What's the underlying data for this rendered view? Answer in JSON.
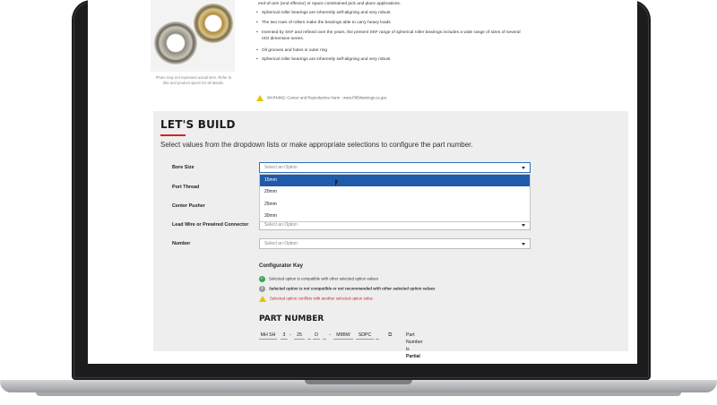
{
  "product": {
    "image_note": "Photo may not represent actual item. Refer to title and product specs for all details.",
    "lead_text": "end-of-arm (end effector) or space constrained pick and place applications.",
    "bullets": [
      "Spherical roller bearings are inherently self-aligning and very robust",
      "The two rows of rollers make the bearings able to carry heavy loads",
      "Invented by SKF and refined over the years, the present SKF range of spherical roller bearings includes a wide range of sizes of several ISO dimension series.",
      "Oil grooves and holes in outer ring",
      "Spherical roller bearings are inherently self-aligning and very robust"
    ],
    "warning": "WARNING: Cancer and Reproductive Harm - www.P65Warnings.ca.gov"
  },
  "build": {
    "title": "LET'S BUILD",
    "subtitle": "Select values from the dropdown lists or make appropriate selections to configure the part number.",
    "fields": [
      {
        "label": "Bore Size",
        "placeholder": "Select an Option"
      },
      {
        "label": "Port Thread",
        "placeholder": ""
      },
      {
        "label": "Center Pusher",
        "placeholder": ""
      },
      {
        "label": "Lead Wire or Prewired Connector",
        "placeholder": "Select an Option"
      },
      {
        "label": "Number",
        "placeholder": "Select an Option"
      }
    ],
    "dropdown_options": [
      "15mm",
      "20mm",
      "25mm",
      "30mm"
    ],
    "highlighted_option": "15mm"
  },
  "key": {
    "title": "Configurator Key",
    "compatible": "Selected option is compatible with other selected option values",
    "not_compatible": "Selected option is not compatible or not recommended with other selected option values",
    "conflict": "Selected option conflicts with another selected option value"
  },
  "part_number": {
    "title": "PART NUMBER",
    "segments": [
      "MH SH",
      "3",
      "25",
      "D",
      "M9BW",
      "SDPC"
    ],
    "status_prefix": "Part Number is",
    "status_value": "Partial"
  },
  "colors": {
    "accent": "#d2232a",
    "highlight": "#1f5ba8",
    "ok": "#3aa655",
    "warn": "#e8c300"
  }
}
